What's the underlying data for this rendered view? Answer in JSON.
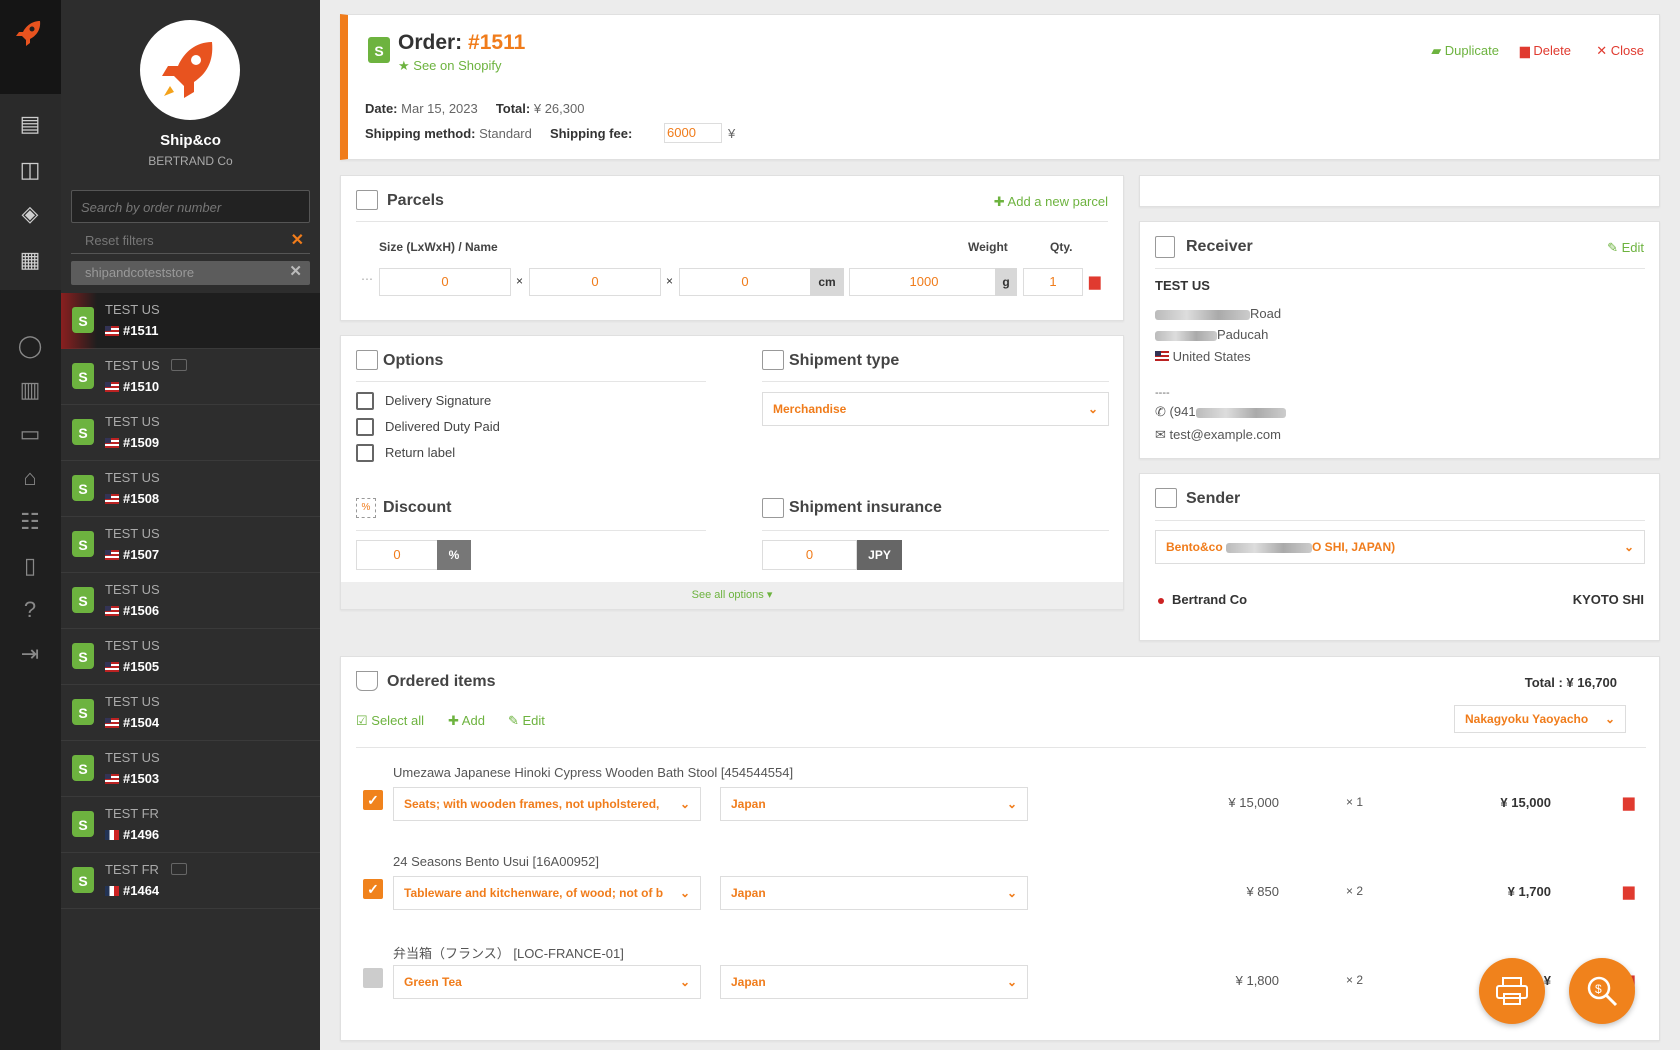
{
  "sidebar": {
    "brand": "Ship&co",
    "company": "BERTRAND Co",
    "search_placeholder": "Search by order number",
    "reset_filters": "Reset filters",
    "active_filter": "shipandcoteststore",
    "orders": [
      {
        "name": "TEST US",
        "number": "#1511",
        "flag": "us",
        "comment": false,
        "active": true
      },
      {
        "name": "TEST US",
        "number": "#1510",
        "flag": "us",
        "comment": true,
        "active": false
      },
      {
        "name": "TEST US",
        "number": "#1509",
        "flag": "us",
        "comment": false,
        "active": false
      },
      {
        "name": "TEST US",
        "number": "#1508",
        "flag": "us",
        "comment": false,
        "active": false
      },
      {
        "name": "TEST US",
        "number": "#1507",
        "flag": "us",
        "comment": false,
        "active": false
      },
      {
        "name": "TEST US",
        "number": "#1506",
        "flag": "us",
        "comment": false,
        "active": false
      },
      {
        "name": "TEST US",
        "number": "#1505",
        "flag": "us",
        "comment": false,
        "active": false
      },
      {
        "name": "TEST US",
        "number": "#1504",
        "flag": "us",
        "comment": false,
        "active": false
      },
      {
        "name": "TEST US",
        "number": "#1503",
        "flag": "us",
        "comment": false,
        "active": false
      },
      {
        "name": "TEST FR",
        "number": "#1496",
        "flag": "fr",
        "comment": false,
        "active": false
      },
      {
        "name": "TEST FR",
        "number": "#1464",
        "flag": "fr",
        "comment": true,
        "active": false
      }
    ]
  },
  "header": {
    "order_label": "Order:",
    "order_number": "#1511",
    "see_on_shopify": "See on Shopify",
    "date_label": "Date:",
    "date": "Mar 15, 2023",
    "total_label": "Total:",
    "total": "¥ 26,300",
    "method_label": "Shipping method:",
    "method": "Standard",
    "fee_label": "Shipping fee:",
    "fee": "6000",
    "fee_unit": "¥",
    "duplicate": "Duplicate",
    "delete": "Delete",
    "close": "Close"
  },
  "parcels": {
    "title": "Parcels",
    "add": "Add a new parcel",
    "col_size": "Size (LxWxH) / Name",
    "col_weight": "Weight",
    "col_qty": "Qty.",
    "l": "0",
    "w": "0",
    "h": "0",
    "dim_unit": "cm",
    "weight": "1000",
    "weight_unit": "g",
    "qty": "1",
    "times": "×"
  },
  "options": {
    "title": "Options",
    "items": [
      "Delivery Signature",
      "Delivered Duty Paid",
      "Return label"
    ],
    "shipment_type_title": "Shipment type",
    "shipment_type": "Merchandise",
    "discount_title": "Discount",
    "discount": "0",
    "discount_unit": "%",
    "insurance_title": "Shipment insurance",
    "insurance": "0",
    "insurance_unit": "JPY",
    "see_all": "See all options ▾"
  },
  "receiver": {
    "title": "Receiver",
    "edit": "Edit",
    "name": "TEST US",
    "street_suffix": "Road",
    "city_suffix": "Paducah",
    "country": "United States",
    "dashes": "----",
    "phone_prefix": "(941",
    "email": "test@example.com"
  },
  "sender": {
    "title": "Sender",
    "select_prefix": "Bento&co",
    "select_suffix": "O SHI, JAPAN)",
    "name": "Bertrand Co",
    "city": "KYOTO SHI"
  },
  "items": {
    "title": "Ordered items",
    "total": "Total : ¥ 16,700",
    "select_all": "Select all",
    "add": "Add",
    "edit": "Edit",
    "location": "Nakagyoku Yaoyacho",
    "rows": [
      {
        "name": "Umezawa Japanese Hinoki Cypress Wooden Bath Stool [454544554]",
        "hs": "Seats; with wooden frames, not upholstered,",
        "origin": "Japan",
        "price": "¥ 15,000",
        "qty": "× 1",
        "total": "¥ 15,000",
        "checked": true
      },
      {
        "name": "24 Seasons Bento Usui [16A00952]",
        "hs": "Tableware and kitchenware, of wood; not of b",
        "origin": "Japan",
        "price": "¥ 850",
        "qty": "× 2",
        "total": "¥ 1,700",
        "checked": true
      },
      {
        "name": "弁当箱（フランス） [LOC-FRANCE-01]",
        "hs": "Green Tea",
        "origin": "Japan",
        "price": "¥ 1,800",
        "qty": "× 2",
        "total": "¥",
        "checked": false
      }
    ]
  },
  "colors": {
    "accent": "#f07c1b",
    "green": "#6db33f",
    "red": "#e03a2f",
    "sidebar": "#2d2d2d"
  }
}
